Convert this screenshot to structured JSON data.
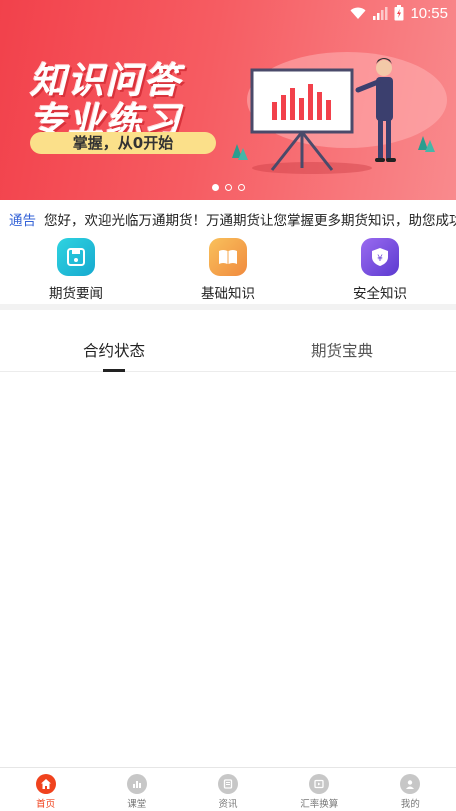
{
  "status_bar": {
    "time": "10:55"
  },
  "banner": {
    "headline_line1": "知识问答",
    "headline_line2": "专业练习",
    "pill_text": "掌握，从0开始",
    "slide_count": 3,
    "active_slide": 1
  },
  "notice": {
    "tag": "通告",
    "message": "您好，欢迎光临万通期货！万通期货让您掌握更多期货知识，助您成功"
  },
  "quick_entries": [
    {
      "label": "期货要闻",
      "icon": "save-icon",
      "color": "#1fc0d6"
    },
    {
      "label": "基础知识",
      "icon": "book-icon",
      "color": "#f5a54a"
    },
    {
      "label": "安全知识",
      "icon": "shield-yen-icon",
      "color": "#7a4fe0"
    }
  ],
  "tabs": [
    {
      "label": "合约状态",
      "active": true
    },
    {
      "label": "期货宝典",
      "active": false
    }
  ],
  "bottom_nav": [
    {
      "label": "首页",
      "icon": "home-icon",
      "active": true
    },
    {
      "label": "课堂",
      "icon": "chart-icon",
      "active": false
    },
    {
      "label": "资讯",
      "icon": "news-icon",
      "active": false
    },
    {
      "label": "汇率换算",
      "icon": "play-icon",
      "active": false
    },
    {
      "label": "我的",
      "icon": "user-icon",
      "active": false
    }
  ],
  "colors": {
    "accent": "#f0421d",
    "banner_red": "#f2414b",
    "notice_tag": "#3563d7"
  }
}
